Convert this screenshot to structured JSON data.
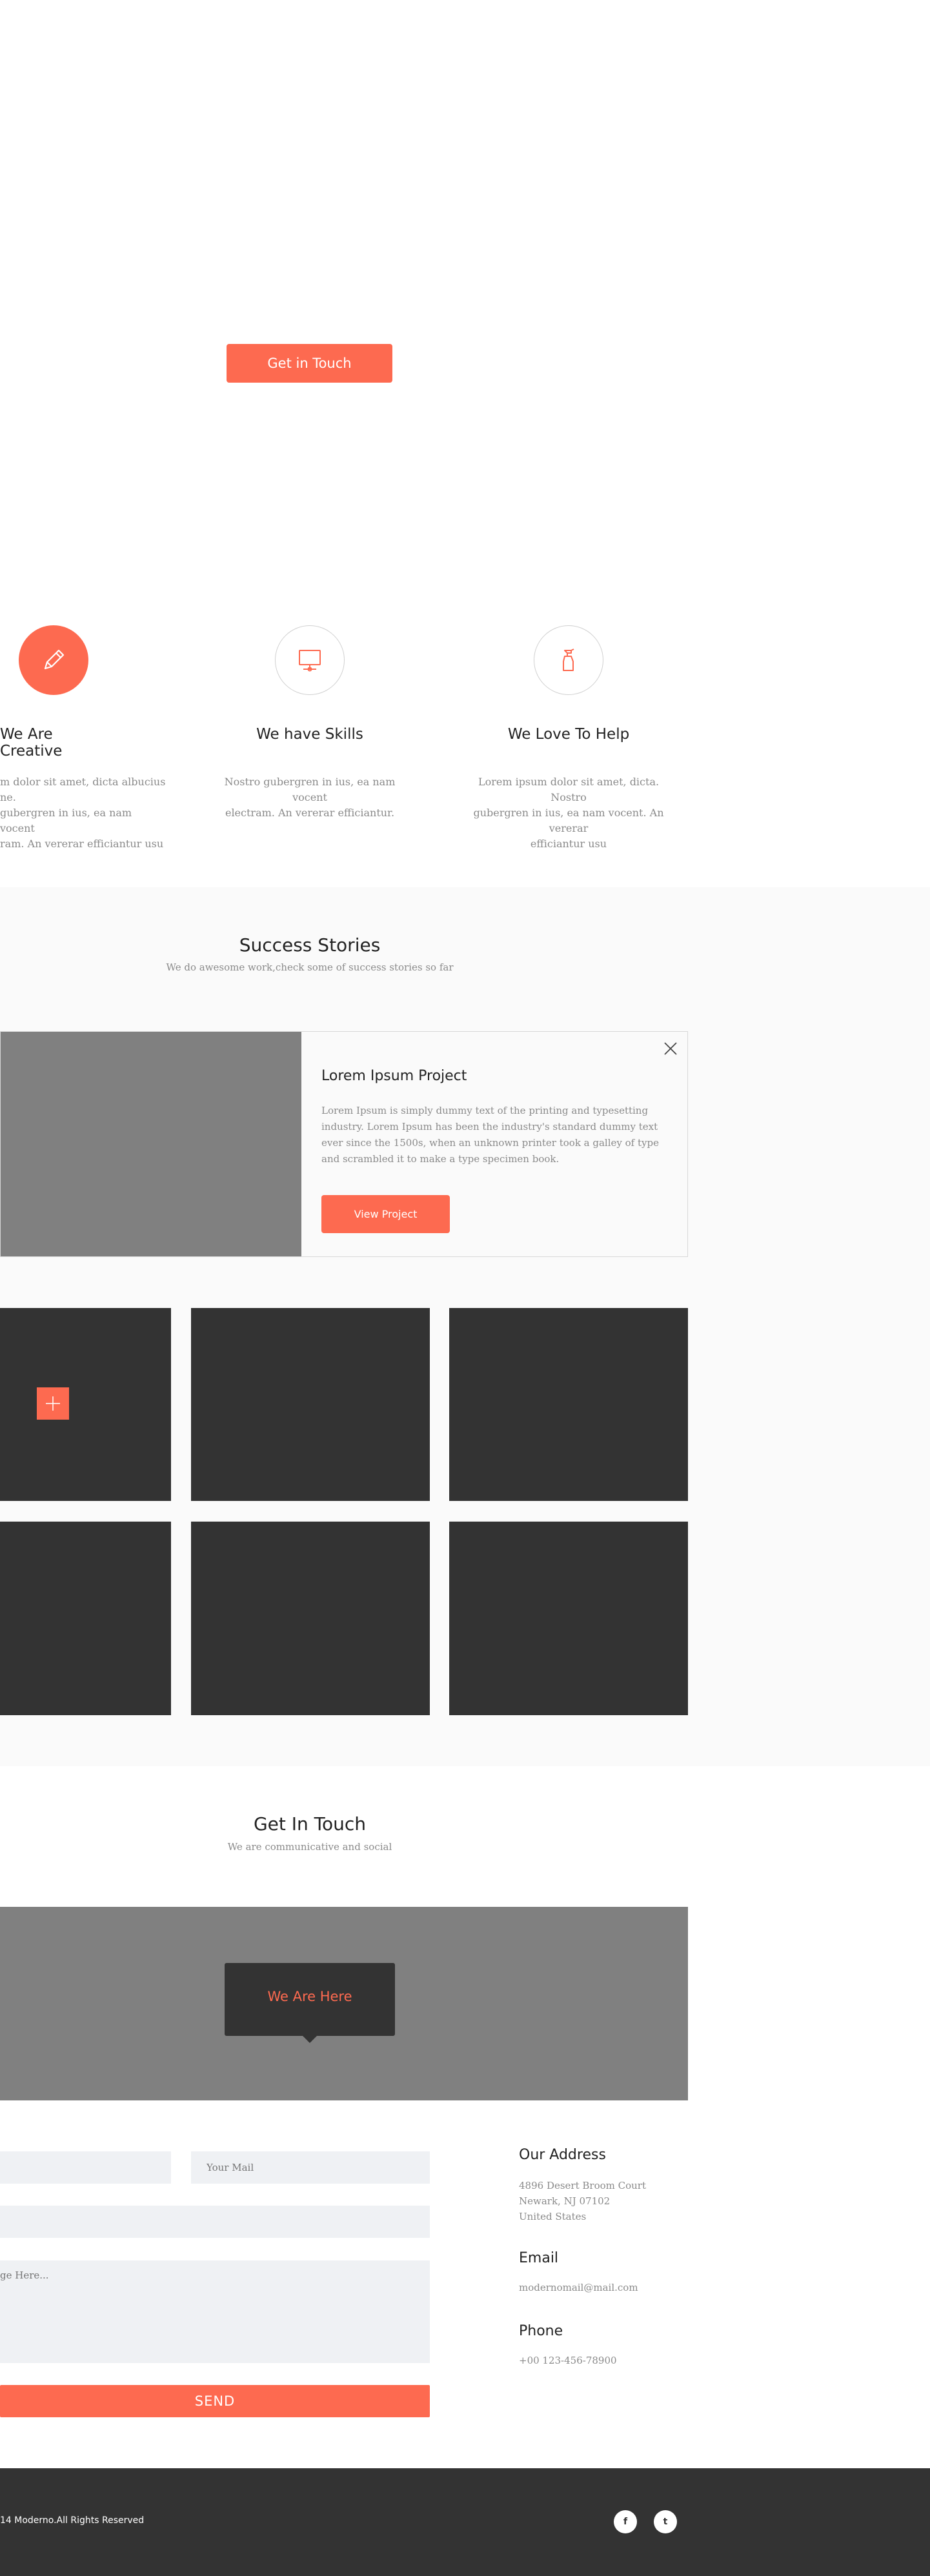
{
  "hero": {
    "cta_label": "Get in Touch"
  },
  "features": [
    {
      "icon": "pencil-icon",
      "title": "We Are Creative",
      "lines": [
        "m dolor sit amet, dicta albucius ne.",
        "gubergren in ius, ea nam vocent",
        "ram. An vererar efficiantur usu"
      ]
    },
    {
      "icon": "monitor-icon",
      "title": "We have Skills",
      "lines": [
        "Nostro gubergren in ius, ea nam vocent",
        "electram. An vererar efficiantur."
      ]
    },
    {
      "icon": "spray-bottle-icon",
      "title": "We Love To Help",
      "lines": [
        "Lorem ipsum dolor sit amet, dicta. Nostro",
        "gubergren in ius, ea nam vocent. An vererar",
        "efficiantur usu"
      ]
    }
  ],
  "portfolio": {
    "title": "Success Stories",
    "subtitle": "We do awesome work,check some of success stories so far",
    "project": {
      "title": "Lorem Ipsum Project",
      "description": "Lorem Ipsum is simply dummy text of the printing and typesetting industry. Lorem Ipsum has been the industry's standard dummy text ever since the 1500s, when an unknown printer took a galley of type and scrambled it to make a type specimen book.",
      "button_label": "View Project"
    }
  },
  "contact": {
    "title": "Get In Touch",
    "subtitle": "We are communicative and social",
    "map_label": "We Are Here",
    "form": {
      "name_placeholder": "",
      "mail_placeholder": "Your Mail",
      "subject_placeholder": "",
      "message_placeholder": "ge Here...",
      "send_label": "SEND"
    },
    "address": {
      "heading": "Our Address",
      "lines": [
        "4896 Desert Broom Court",
        "Newark, NJ 07102",
        "United States"
      ]
    },
    "email": {
      "heading": "Email",
      "value": "modernomail@mail.com"
    },
    "phone": {
      "heading": "Phone",
      "value": "+00 123-456-78900"
    }
  },
  "footer": {
    "copyright": "14 Moderno.All Rights Reserved",
    "social": [
      {
        "icon": "facebook-icon",
        "glyph": "f"
      },
      {
        "icon": "twitter-icon",
        "glyph": "t"
      }
    ]
  },
  "colors": {
    "accent": "#fd6a50",
    "dark": "#333333",
    "gray": "#808080",
    "light_bg": "#fafafa",
    "field_bg": "#eff1f4"
  }
}
